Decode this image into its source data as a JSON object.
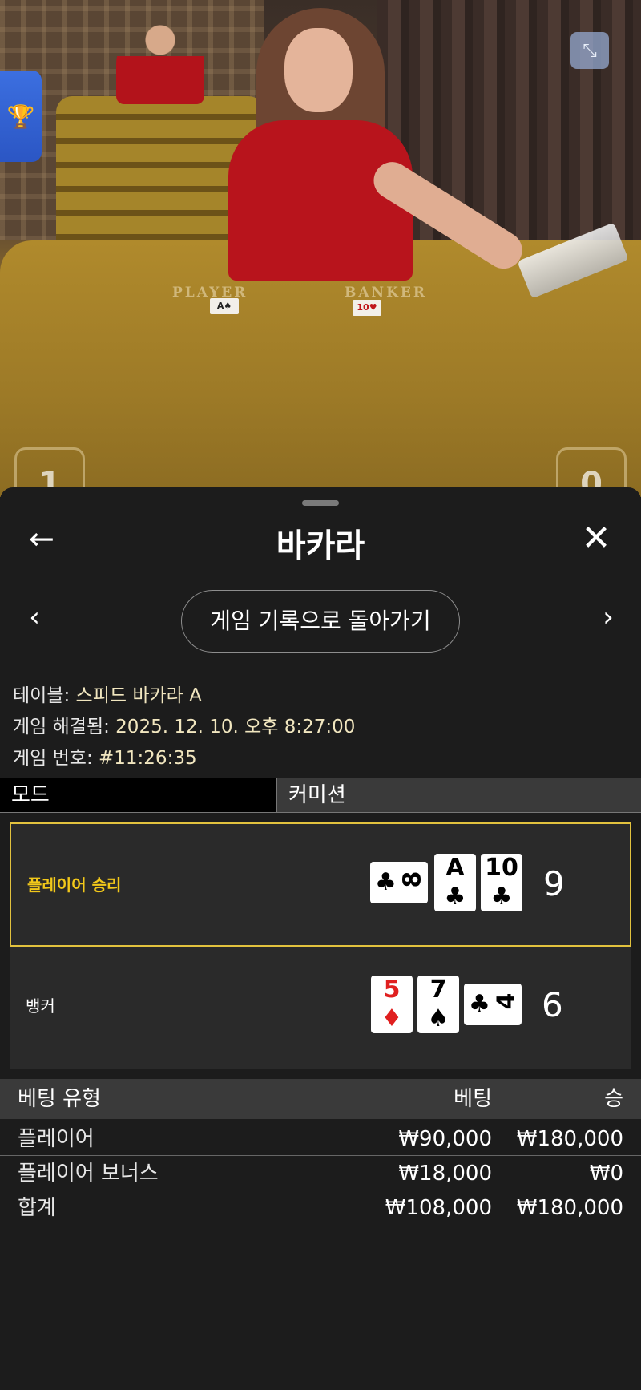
{
  "video": {
    "felt_labels": {
      "player": "PLAYER",
      "banker": "BANKER"
    },
    "player_peek_digit": "1",
    "banker_peek_digit": "0",
    "minimize_icon": "minimize-icon",
    "trophy_icon": "trophy-icon"
  },
  "header": {
    "title": "바카라",
    "back_icon": "arrow-left-icon",
    "close_icon": "close-icon"
  },
  "nav": {
    "history_button": "게임 기록으로 돌아가기",
    "prev_icon": "chevron-left-icon",
    "next_icon": "chevron-right-icon"
  },
  "meta": {
    "table_label": "테이블: ",
    "table_value": "스피드 바카라 A",
    "resolved_label": "게임 해결됨: ",
    "resolved_value": "2025. 12. 10. 오후 8:27:00",
    "number_label": "게임 번호: ",
    "number_value": "#11:26:35"
  },
  "mode": {
    "label": "모드",
    "value": "커미션"
  },
  "outcome": {
    "player": {
      "label": "플레이어 승리",
      "score": "9",
      "cards": [
        {
          "rank": "8",
          "suit": "♣",
          "orientation": "horizontal"
        },
        {
          "rank": "A",
          "suit": "♣",
          "orientation": "vertical"
        },
        {
          "rank": "10",
          "suit": "♣",
          "orientation": "vertical"
        }
      ]
    },
    "banker": {
      "label": "뱅커",
      "score": "6",
      "cards": [
        {
          "rank": "5",
          "suit": "♦",
          "orientation": "vertical"
        },
        {
          "rank": "7",
          "suit": "♠",
          "orientation": "vertical"
        },
        {
          "rank": "4",
          "suit": "♣",
          "orientation": "horizontal"
        }
      ]
    }
  },
  "bets": {
    "headers": {
      "type": "베팅 유형",
      "bet": "베팅",
      "win": "승"
    },
    "rows": [
      {
        "type": "플레이어",
        "bet": "₩90,000",
        "win": "₩180,000"
      },
      {
        "type": "플레이어 보너스",
        "bet": "₩18,000",
        "win": "₩0"
      }
    ],
    "total": {
      "type": "합계",
      "bet": "₩108,000",
      "win": "₩180,000"
    }
  },
  "colors": {
    "win_highlight": "#e2c23e",
    "win_text": "#f2c81a",
    "meta_value": "#f1e6bf"
  }
}
